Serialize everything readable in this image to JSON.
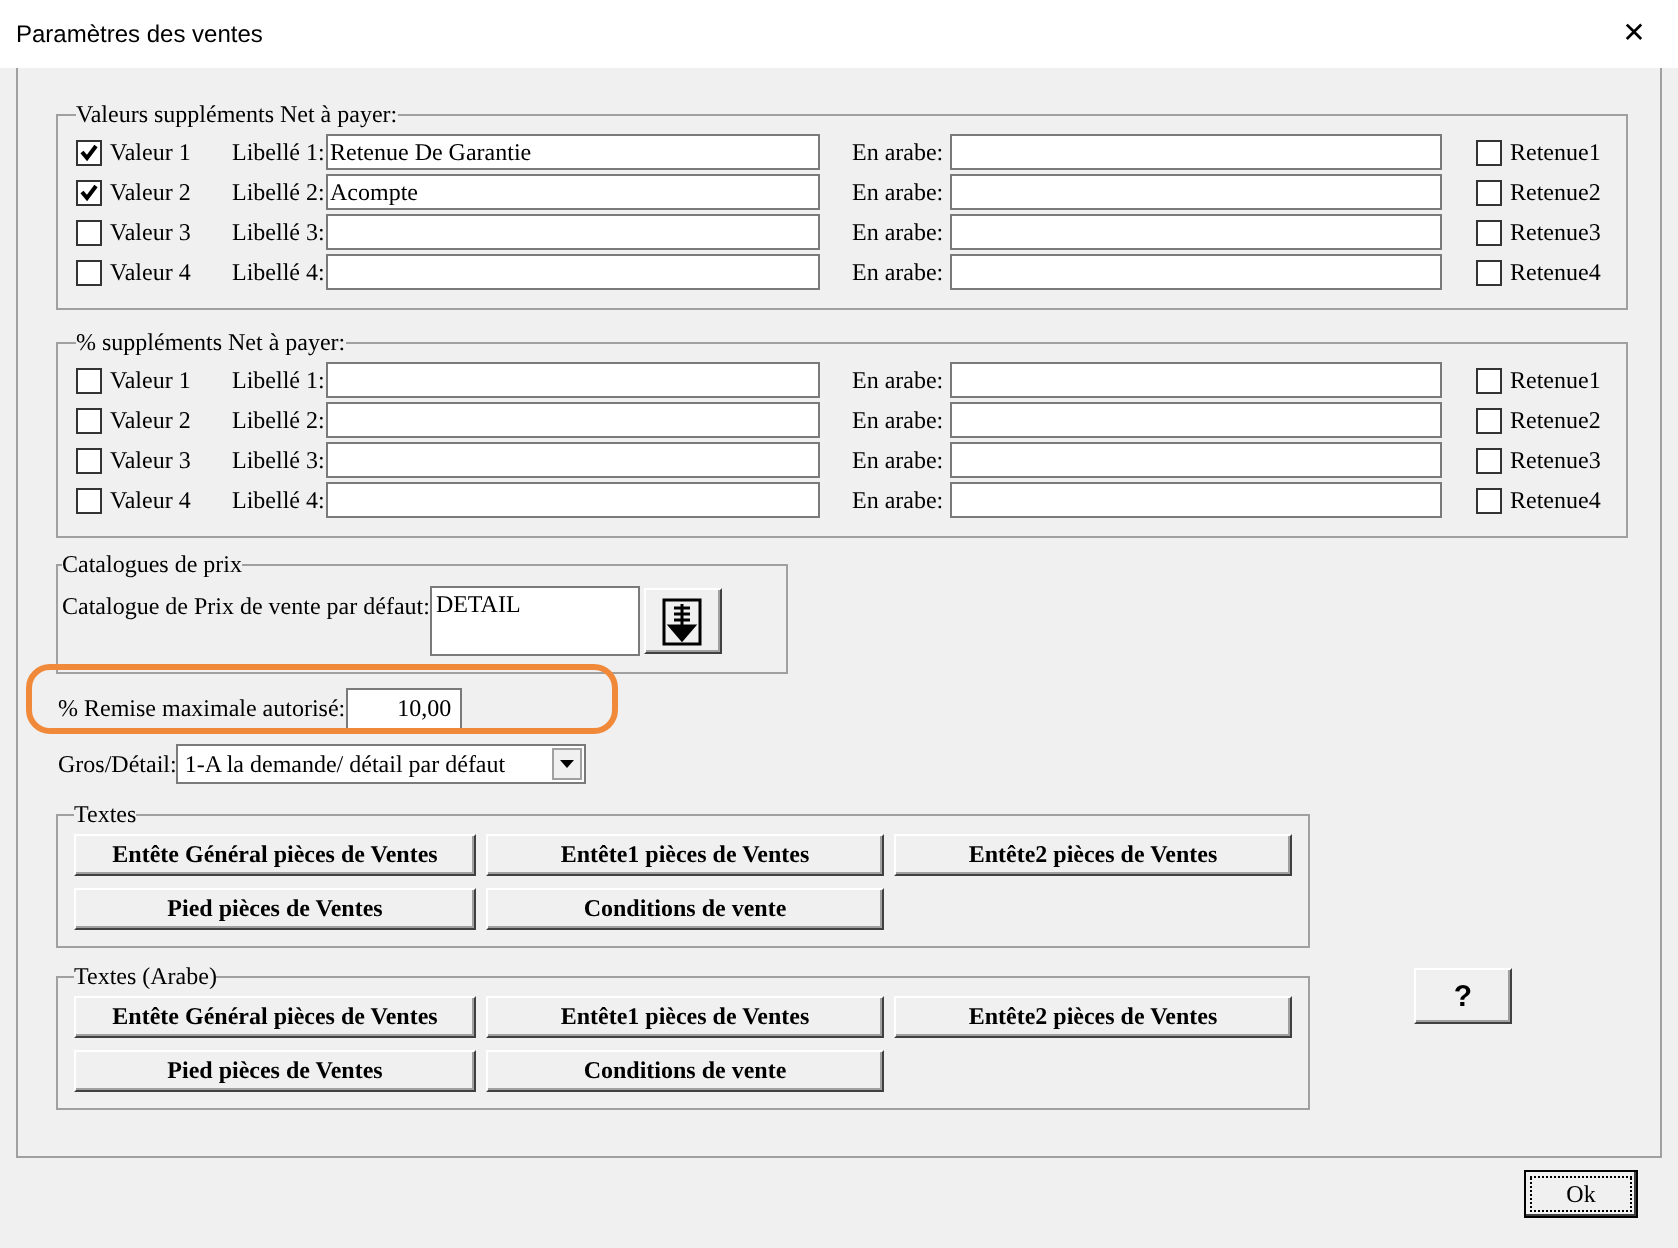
{
  "window": {
    "title": "Paramètres des ventes",
    "close": "✕"
  },
  "groups": [
    {
      "title": "Valeurs suppléments Net à payer:",
      "rows": [
        {
          "value_label": "Valeur 1",
          "checked": true,
          "libelle_label": "Libellé 1:",
          "libelle": "Retenue De Garantie",
          "arabe_label": "En arabe:",
          "retenue_label": "Retenue1",
          "retenue_checked": false
        },
        {
          "value_label": "Valeur 2",
          "checked": true,
          "libelle_label": "Libellé 2:",
          "libelle": "Acompte",
          "arabe_label": "En arabe:",
          "retenue_label": "Retenue2",
          "retenue_checked": false
        },
        {
          "value_label": "Valeur 3",
          "checked": false,
          "libelle_label": "Libellé 3:",
          "arabe_label": "En arabe:",
          "retenue_label": "Retenue3",
          "retenue_checked": false
        },
        {
          "value_label": "Valeur 4",
          "checked": false,
          "libelle_label": "Libellé 4:",
          "arabe_label": "En arabe:",
          "retenue_label": "Retenue4",
          "retenue_checked": false
        }
      ]
    },
    {
      "title": "% suppléments Net à payer:",
      "rows": [
        {
          "value_label": "Valeur 1",
          "checked": false,
          "libelle_label": "Libellé 1:",
          "arabe_label": "En arabe:",
          "retenue_label": "Retenue1",
          "retenue_checked": false
        },
        {
          "value_label": "Valeur 2",
          "checked": false,
          "libelle_label": "Libellé 2:",
          "arabe_label": "En arabe:",
          "retenue_label": "Retenue2",
          "retenue_checked": false
        },
        {
          "value_label": "Valeur 3",
          "checked": false,
          "libelle_label": "Libellé 3:",
          "arabe_label": "En arabe:",
          "retenue_label": "Retenue3",
          "retenue_checked": false
        },
        {
          "value_label": "Valeur 4",
          "checked": false,
          "libelle_label": "Libellé 4:",
          "arabe_label": "En arabe:",
          "retenue_label": "Retenue4",
          "retenue_checked": false
        }
      ]
    }
  ],
  "catalogue": {
    "title": "Catalogues de prix",
    "label": "Catalogue de Prix de vente par défaut:",
    "value": "DETAIL"
  },
  "remise": {
    "label": "% Remise maximale autorisé:",
    "value": "10,00",
    "highlighted": true
  },
  "gros_detail": {
    "label": "Gros/Détail:",
    "value": "1-A la demande/ détail par défaut"
  },
  "text_groups": [
    {
      "title": "Textes",
      "buttons": [
        "Entête Général pièces de Ventes",
        "Entête1 pièces de Ventes",
        "Entête2 pièces de Ventes",
        "Pied pièces de Ventes",
        "Conditions de vente"
      ]
    },
    {
      "title": "Textes (Arabe)",
      "buttons": [
        "Entête Général pièces de Ventes",
        "Entête1 pièces de Ventes",
        "Entête2 pièces de Ventes",
        "Pied pièces de Ventes",
        "Conditions de vente"
      ]
    }
  ],
  "help_button": "?",
  "ok_button": "Ok"
}
